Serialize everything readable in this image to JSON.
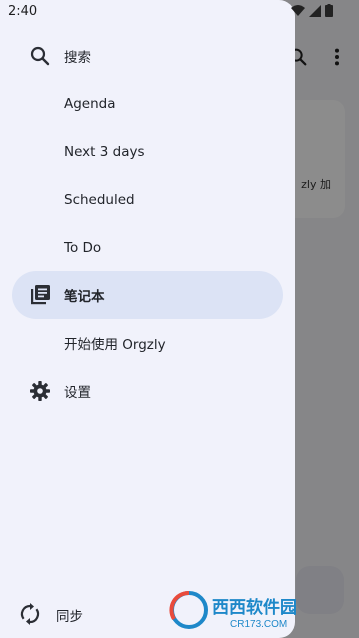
{
  "status_bar": {
    "time": "2:40"
  },
  "background": {
    "card_text": "zly 加"
  },
  "drawer": {
    "items": [
      {
        "label": "搜索",
        "icon": "search-icon"
      },
      {
        "label": "Agenda"
      },
      {
        "label": "Next 3 days"
      },
      {
        "label": "Scheduled"
      },
      {
        "label": "To Do"
      },
      {
        "label": "笔记本",
        "icon": "notebooks-icon",
        "selected": true
      },
      {
        "label": "开始使用 Orgzly"
      },
      {
        "label": "设置",
        "icon": "gear-icon"
      }
    ],
    "sync_label": "同步"
  },
  "watermark": {
    "line1": "西西软件园",
    "line2": "CR173.COM"
  },
  "colors": {
    "drawer_bg": "#f1f2fb",
    "selected_bg": "#dce3f5",
    "text": "#22252b"
  }
}
